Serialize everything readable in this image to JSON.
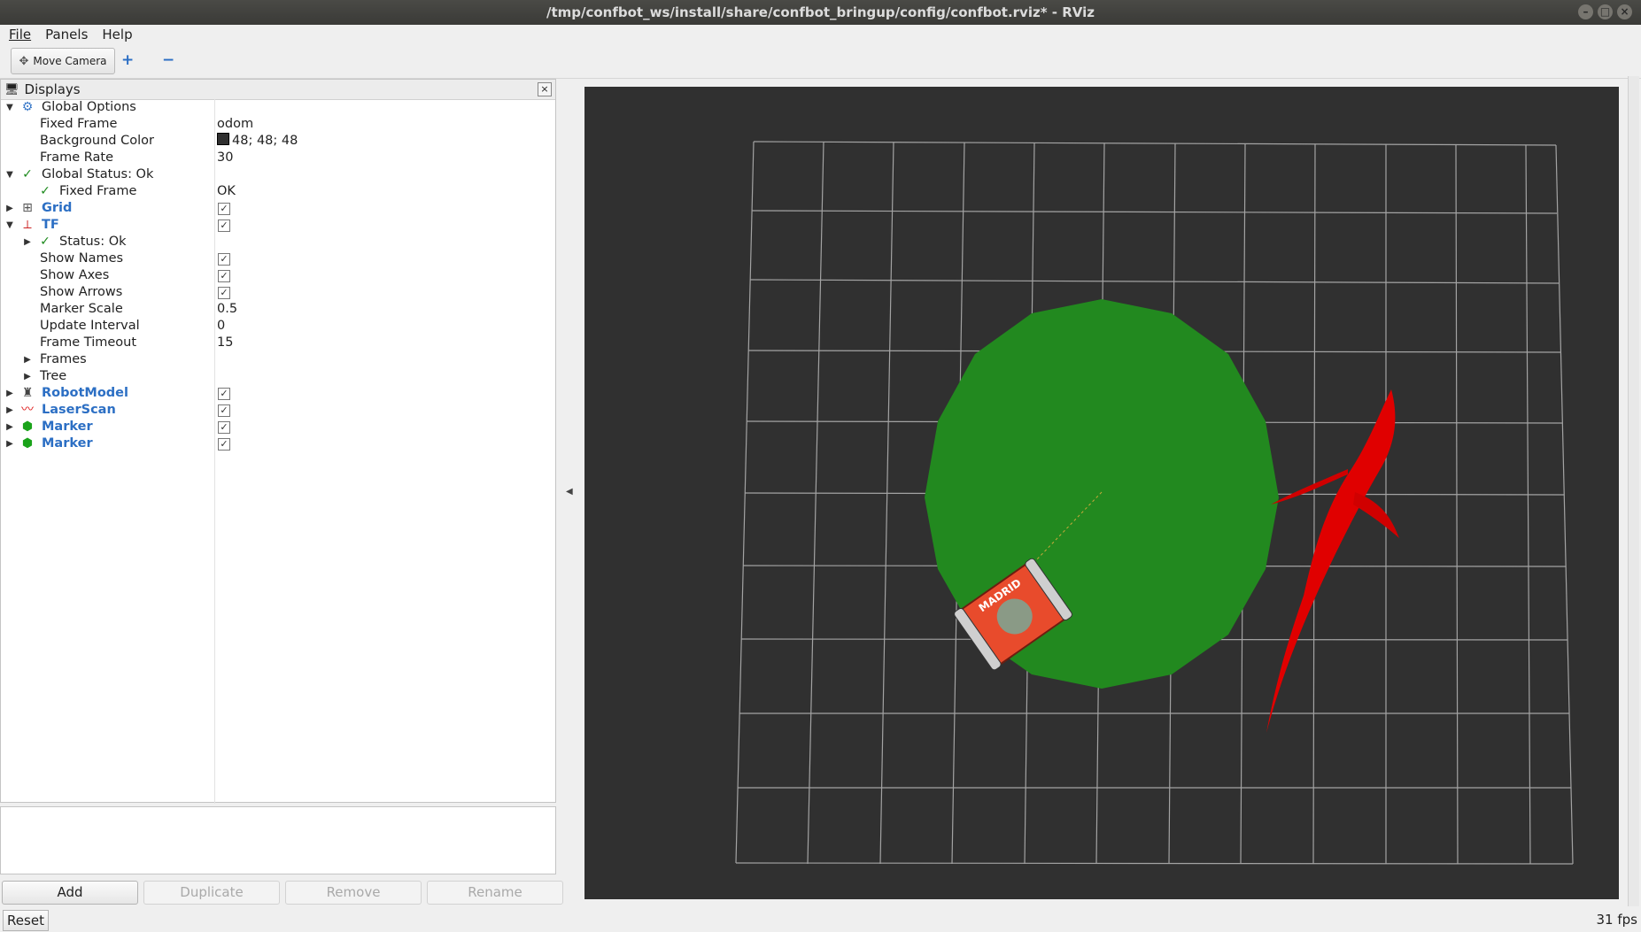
{
  "window": {
    "title": "/tmp/confbot_ws/install/share/confbot_bringup/config/confbot.rviz* - RViz"
  },
  "menu": {
    "file": "File",
    "panels": "Panels",
    "help": "Help"
  },
  "toolbar": {
    "move_camera": "Move Camera",
    "add_tool": "+",
    "remove_tool": "−"
  },
  "displays": {
    "title": "Displays",
    "global_options": "Global Options",
    "fixed_frame_label": "Fixed Frame",
    "fixed_frame_value": "odom",
    "bg_color_label": "Background Color",
    "bg_color_value": "48; 48; 48",
    "frame_rate_label": "Frame Rate",
    "frame_rate_value": "30",
    "global_status": "Global Status: Ok",
    "status_fixed_frame_label": "Fixed Frame",
    "status_fixed_frame_value": "OK",
    "grid": "Grid",
    "tf": "TF",
    "tf_status": "Status: Ok",
    "show_names": "Show Names",
    "show_axes": "Show Axes",
    "show_arrows": "Show Arrows",
    "marker_scale_label": "Marker Scale",
    "marker_scale_value": "0.5",
    "update_interval_label": "Update Interval",
    "update_interval_value": "0",
    "frame_timeout_label": "Frame Timeout",
    "frame_timeout_value": "15",
    "frames": "Frames",
    "tree": "Tree",
    "robot_model": "RobotModel",
    "laser_scan": "LaserScan",
    "marker1": "Marker",
    "marker2": "Marker"
  },
  "buttons": {
    "add": "Add",
    "duplicate": "Duplicate",
    "remove": "Remove",
    "rename": "Rename",
    "reset": "Reset"
  },
  "status": {
    "fps": "31 fps"
  },
  "colors": {
    "background": "#303030",
    "marker_green": "#22891f",
    "shark_red": "#e00000",
    "grid_line": "#a0a0a0"
  },
  "robot_label": "MADRID"
}
